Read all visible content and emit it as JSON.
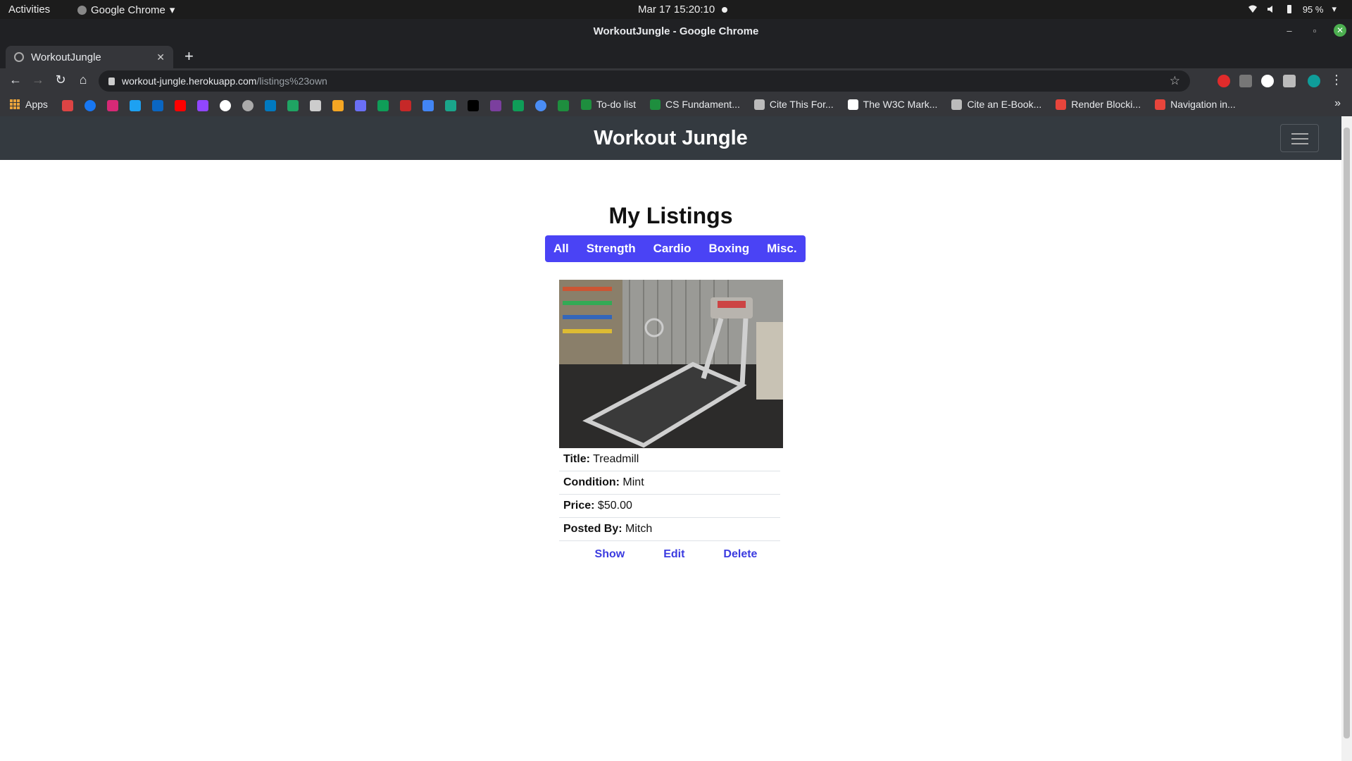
{
  "os_bar": {
    "activities": "Activities",
    "app_name": "Google Chrome",
    "datetime": "Mar 17  15:20:10",
    "battery": "95 %"
  },
  "window": {
    "title": "WorkoutJungle - Google Chrome"
  },
  "tab": {
    "title": "WorkoutJungle"
  },
  "address": {
    "host": "workout-jungle.herokuapp.com",
    "path": "/listings%23own"
  },
  "bookmarks": {
    "apps_label": "Apps",
    "named": [
      {
        "label": "To-do list",
        "color": "#1e8e3e"
      },
      {
        "label": "CS Fundament...",
        "color": "#1e8e3e"
      },
      {
        "label": "Cite This For...",
        "color": "#bbbbbb"
      },
      {
        "label": "The W3C Mark...",
        "color": "#ffffff"
      },
      {
        "label": "Cite an E-Book...",
        "color": "#bbbbbb"
      },
      {
        "label": "Render Blocki...",
        "color": "#e8453c"
      },
      {
        "label": "Navigation in...",
        "color": "#e8453c"
      }
    ]
  },
  "site": {
    "brand": "Workout Jungle",
    "heading": "My Listings",
    "filters": [
      "All",
      "Strength",
      "Cardio",
      "Boxing",
      "Misc."
    ],
    "accent_color": "#4a43f5",
    "navbar_color": "#343a40"
  },
  "listing": {
    "image_alt": "treadmill-photo",
    "title_label": "Title:",
    "title": "Treadmill",
    "condition_label": "Condition:",
    "condition": "Mint",
    "price_label": "Price:",
    "price": "$50.00",
    "posted_label": "Posted By:",
    "posted_by": "Mitch",
    "actions": [
      "Show",
      "Edit",
      "Delete"
    ]
  }
}
